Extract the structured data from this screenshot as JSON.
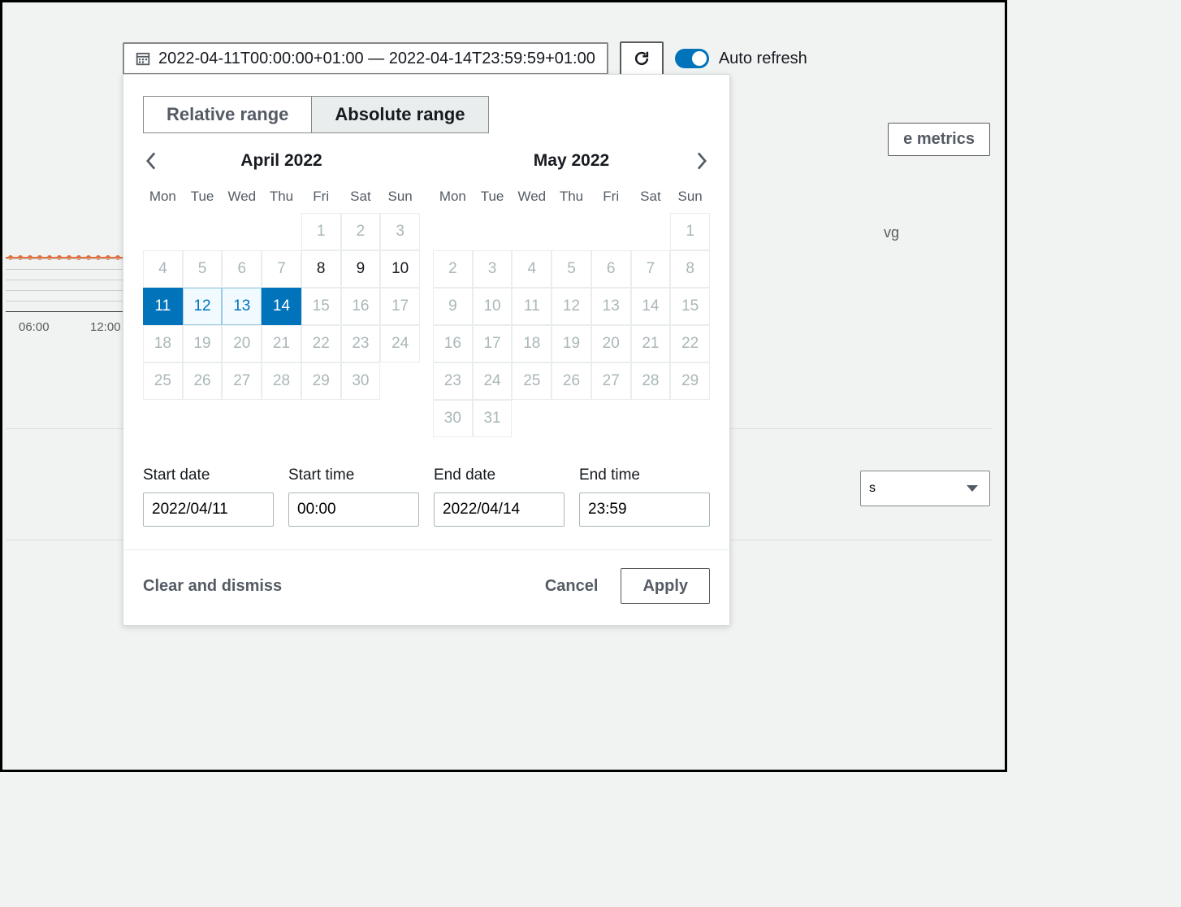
{
  "toolbar": {
    "date_range_label": "2022-04-11T00:00:00+01:00 — 2022-04-14T23:59:59+01:00",
    "auto_refresh_label": "Auto refresh"
  },
  "background": {
    "metrics_button": "e metrics",
    "vg_label": "vg",
    "tick1": "06:00",
    "tick2": "12:00",
    "dropdown_trailing": "s"
  },
  "popover": {
    "tabs": {
      "relative": "Relative range",
      "absolute": "Absolute range"
    },
    "weekdays": [
      "Mon",
      "Tue",
      "Wed",
      "Thu",
      "Fri",
      "Sat",
      "Sun"
    ],
    "month_left": {
      "title": "April 2022",
      "days": [
        {
          "n": "",
          "t": "empty"
        },
        {
          "n": "",
          "t": "empty"
        },
        {
          "n": "",
          "t": "empty"
        },
        {
          "n": "",
          "t": "empty"
        },
        {
          "n": "1",
          "t": "disabled"
        },
        {
          "n": "2",
          "t": "disabled"
        },
        {
          "n": "3",
          "t": "disabled"
        },
        {
          "n": "4",
          "t": "disabled"
        },
        {
          "n": "5",
          "t": "disabled"
        },
        {
          "n": "6",
          "t": "disabled"
        },
        {
          "n": "7",
          "t": "disabled"
        },
        {
          "n": "8",
          "t": "active"
        },
        {
          "n": "9",
          "t": "active"
        },
        {
          "n": "10",
          "t": "active"
        },
        {
          "n": "11",
          "t": "sel-start"
        },
        {
          "n": "12",
          "t": "sel-mid"
        },
        {
          "n": "13",
          "t": "sel-mid"
        },
        {
          "n": "14",
          "t": "sel-end"
        },
        {
          "n": "15",
          "t": "disabled"
        },
        {
          "n": "16",
          "t": "disabled"
        },
        {
          "n": "17",
          "t": "disabled"
        },
        {
          "n": "18",
          "t": "disabled"
        },
        {
          "n": "19",
          "t": "disabled"
        },
        {
          "n": "20",
          "t": "disabled"
        },
        {
          "n": "21",
          "t": "disabled"
        },
        {
          "n": "22",
          "t": "disabled"
        },
        {
          "n": "23",
          "t": "disabled"
        },
        {
          "n": "24",
          "t": "disabled"
        },
        {
          "n": "25",
          "t": "disabled"
        },
        {
          "n": "26",
          "t": "disabled"
        },
        {
          "n": "27",
          "t": "disabled"
        },
        {
          "n": "28",
          "t": "disabled"
        },
        {
          "n": "29",
          "t": "disabled"
        },
        {
          "n": "30",
          "t": "disabled"
        },
        {
          "n": "",
          "t": "empty"
        }
      ]
    },
    "month_right": {
      "title": "May 2022",
      "days": [
        {
          "n": "",
          "t": "empty"
        },
        {
          "n": "",
          "t": "empty"
        },
        {
          "n": "",
          "t": "empty"
        },
        {
          "n": "",
          "t": "empty"
        },
        {
          "n": "",
          "t": "empty"
        },
        {
          "n": "",
          "t": "empty"
        },
        {
          "n": "1",
          "t": "disabled"
        },
        {
          "n": "2",
          "t": "disabled"
        },
        {
          "n": "3",
          "t": "disabled"
        },
        {
          "n": "4",
          "t": "disabled"
        },
        {
          "n": "5",
          "t": "disabled"
        },
        {
          "n": "6",
          "t": "disabled"
        },
        {
          "n": "7",
          "t": "disabled"
        },
        {
          "n": "8",
          "t": "disabled"
        },
        {
          "n": "9",
          "t": "disabled"
        },
        {
          "n": "10",
          "t": "disabled"
        },
        {
          "n": "11",
          "t": "disabled"
        },
        {
          "n": "12",
          "t": "disabled"
        },
        {
          "n": "13",
          "t": "disabled"
        },
        {
          "n": "14",
          "t": "disabled"
        },
        {
          "n": "15",
          "t": "disabled"
        },
        {
          "n": "16",
          "t": "disabled"
        },
        {
          "n": "17",
          "t": "disabled"
        },
        {
          "n": "18",
          "t": "disabled"
        },
        {
          "n": "19",
          "t": "disabled"
        },
        {
          "n": "20",
          "t": "disabled"
        },
        {
          "n": "21",
          "t": "disabled"
        },
        {
          "n": "22",
          "t": "disabled"
        },
        {
          "n": "23",
          "t": "disabled"
        },
        {
          "n": "24",
          "t": "disabled"
        },
        {
          "n": "25",
          "t": "disabled"
        },
        {
          "n": "26",
          "t": "disabled"
        },
        {
          "n": "27",
          "t": "disabled"
        },
        {
          "n": "28",
          "t": "disabled"
        },
        {
          "n": "29",
          "t": "disabled"
        },
        {
          "n": "30",
          "t": "disabled"
        },
        {
          "n": "31",
          "t": "disabled"
        },
        {
          "n": "",
          "t": "empty"
        },
        {
          "n": "",
          "t": "empty"
        },
        {
          "n": "",
          "t": "empty"
        },
        {
          "n": "",
          "t": "empty"
        },
        {
          "n": "",
          "t": "empty"
        }
      ]
    },
    "inputs": {
      "start_date_label": "Start date",
      "start_date_value": "2022/04/11",
      "start_time_label": "Start time",
      "start_time_value": "00:00",
      "end_date_label": "End date",
      "end_date_value": "2022/04/14",
      "end_time_label": "End time",
      "end_time_value": "23:59"
    },
    "footer": {
      "clear": "Clear and dismiss",
      "cancel": "Cancel",
      "apply": "Apply"
    }
  }
}
